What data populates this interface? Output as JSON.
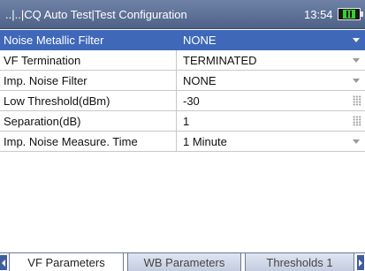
{
  "header": {
    "title": "..|..|CQ Auto Test|Test Configuration",
    "time": "13:54",
    "battery_icon": "battery-charging-icon"
  },
  "rows": [
    {
      "label": "Noise Metallic Filter",
      "value": "NONE",
      "control": "dropdown",
      "selected": true
    },
    {
      "label": "VF Termination",
      "value": "TERMINATED",
      "control": "dropdown",
      "selected": false
    },
    {
      "label": "Imp. Noise Filter",
      "value": "NONE",
      "control": "dropdown",
      "selected": false
    },
    {
      "label": "Low Threshold(dBm)",
      "value": "-30",
      "control": "keypad",
      "selected": false
    },
    {
      "label": "Separation(dB)",
      "value": "1",
      "control": "keypad",
      "selected": false
    },
    {
      "label": "Imp. Noise Measure. Time",
      "value": "1 Minute",
      "control": "dropdown",
      "selected": false
    }
  ],
  "tabs": [
    {
      "label": "VF Parameters",
      "active": true
    },
    {
      "label": "WB Parameters",
      "active": false
    },
    {
      "label": "Thresholds 1",
      "active": false
    }
  ],
  "colors": {
    "header": "#4e6187",
    "selection": "#3f68b9",
    "battery_fill": "#35d12f"
  }
}
